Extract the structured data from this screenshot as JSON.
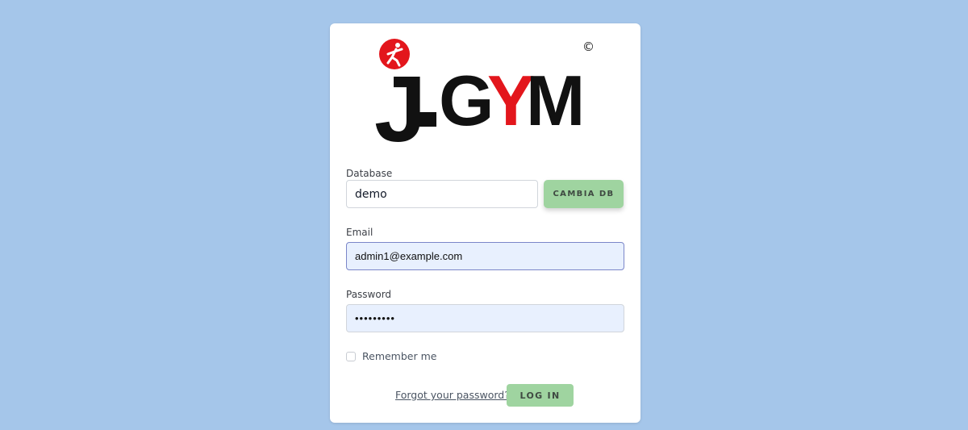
{
  "logo": {
    "brand_letters": [
      "J",
      "-",
      "G",
      "Y",
      "M"
    ],
    "copyright_symbol": "©",
    "icon_name": "running-person-icon",
    "colors": {
      "black": "#111111",
      "red": "#e3161c"
    }
  },
  "database": {
    "label": "Database",
    "value": "demo",
    "change_button": "CAMBIA DB"
  },
  "email": {
    "label": "Email",
    "value": "admin1@example.com"
  },
  "password": {
    "label": "Password",
    "value": "•••••••••"
  },
  "remember": {
    "label": "Remember me",
    "checked": false
  },
  "forgot_link": "Forgot your password?",
  "login_button": "LOG IN",
  "colors": {
    "page_background": "#a5c6ea",
    "button_green": "#9fd4a0",
    "autofill_background": "#e8f0fe"
  }
}
